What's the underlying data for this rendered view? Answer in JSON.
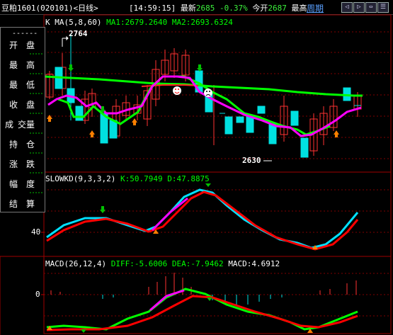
{
  "header": {
    "symbol": "豆粕1601",
    "code": "(020101)",
    "period": "<日线>",
    "time": "[14:59:15]",
    "latest_label": "最新",
    "latest_value": "2685",
    "change_pct": "-0.37%",
    "open_label": "今开",
    "open_value": "2687",
    "high_label_partial": "最高",
    "cycle_link": "周期"
  },
  "nav_buttons": [
    "◁",
    "▷",
    "⇔",
    "☰"
  ],
  "sidepanel": {
    "separator": "------",
    "rows": [
      {
        "a": "开",
        "b": "盘"
      },
      {
        "a": "最",
        "b": "高"
      },
      {
        "a": "最",
        "b": "低"
      },
      {
        "a": "收",
        "b": "盘"
      },
      {
        "a": "成",
        "b": "交量"
      },
      {
        "a": "持",
        "b": "仓"
      },
      {
        "a": "涨",
        "b": "跌"
      },
      {
        "a": "幅",
        "b": "度"
      },
      {
        "a": "结",
        "b": "算"
      }
    ]
  },
  "price_panel": {
    "k_label": "K",
    "ma_label": "MA(5,8,60)",
    "ma1": "MA1:2679.2640",
    "ma2": "MA2:2693.6324",
    "high_mark": "2764",
    "low_mark": "2630"
  },
  "kd_panel": {
    "label": "SLOWKD(9,3,3,2)",
    "k": "K:50.7949",
    "d": "D:47.8875",
    "level": "40"
  },
  "macd_panel": {
    "label": "MACD(26,12,4)",
    "diff": "DIFF:-5.6006",
    "dea": "DEA:-7.9462",
    "macd": "MACD:4.6912",
    "zero": "0"
  },
  "colors": {
    "up": "#ff3232",
    "down": "#00e0e0",
    "ma_green": "#00ff00",
    "ma_magenta": "#ff00ff",
    "grid": "#800000"
  }
}
